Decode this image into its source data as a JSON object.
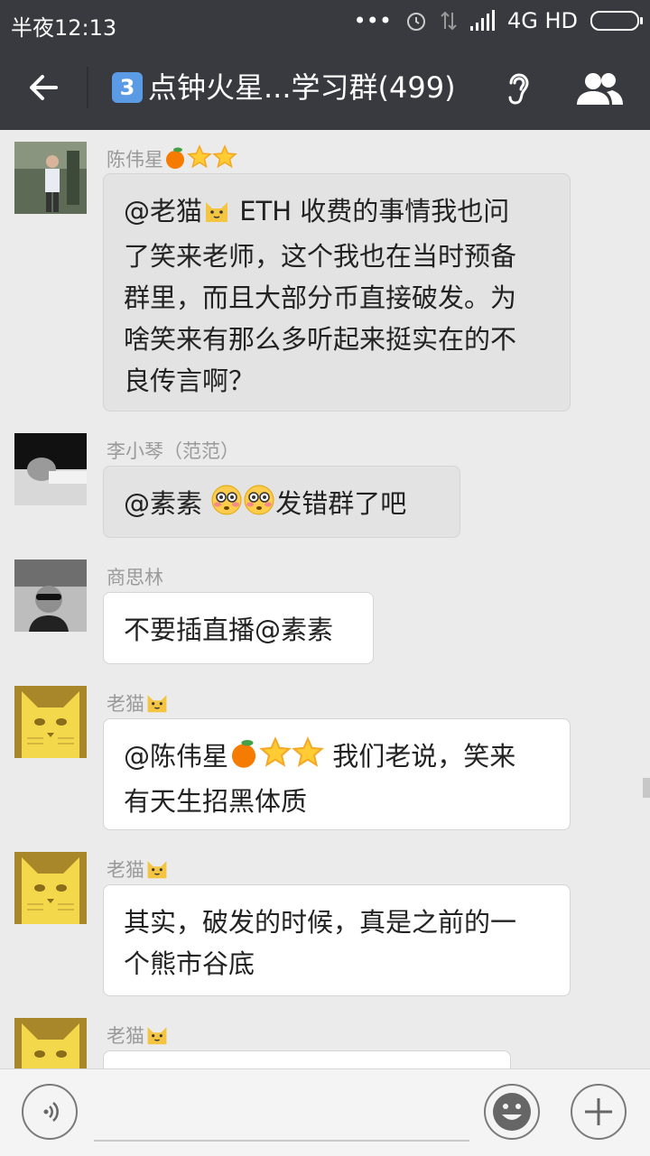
{
  "status_bar": {
    "time": "半夜12:13",
    "network": "4G HD"
  },
  "header": {
    "badge": "3",
    "title": "点钟火星...学习群(499)"
  },
  "messages": [
    {
      "sender": "陈伟星",
      "text": [
        "@老猫",
        " ETH 收费的事情我也问",
        "了笑来老师，这个我也在当时预备",
        "群里，而且大部分币直接破发。为",
        "啥笑来有那么多听起来挺实在的不",
        "良传言啊？"
      ]
    },
    {
      "sender": "李小琴（范范）",
      "text": [
        "@素素 ",
        "发错群了吧"
      ]
    },
    {
      "sender": "商思林",
      "text": [
        "不要插直播@素素"
      ]
    },
    {
      "sender": "老猫",
      "text": [
        "@陈伟星",
        " 我们老说，笑来",
        "有天生招黑体质"
      ]
    },
    {
      "sender": "老猫",
      "text": [
        "其实，破发的时候，真是之前的一",
        "个熊市谷底"
      ]
    },
    {
      "sender": "老猫",
      "text": []
    }
  ],
  "icons": {
    "back": "back-arrow-icon",
    "ear": "ear-icon",
    "group": "group-members-icon",
    "voice": "voice-input-icon",
    "emoji": "emoji-icon",
    "more": "plus-icon",
    "cat": "cat-emoji",
    "orange": "orange-emoji",
    "star": "star-emoji",
    "flushed": "flushed-face-emoji"
  },
  "colors": {
    "bar": "#393a3f",
    "chat_bg": "#ebebeb",
    "bubble_gray": "#e3e3e3",
    "bubble_white": "#ffffff",
    "sender": "#9a9a9a"
  }
}
